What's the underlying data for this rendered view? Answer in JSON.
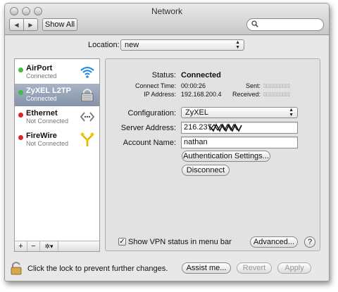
{
  "window": {
    "title": "Network"
  },
  "toolbar": {
    "show_all": "Show All",
    "search_placeholder": ""
  },
  "location": {
    "label": "Location:",
    "value": "new"
  },
  "services": [
    {
      "name": "AirPort",
      "status": "Connected",
      "dot_color": "#3fbf3f",
      "icon": "wifi-icon"
    },
    {
      "name": "ZyXEL L2TP",
      "status": "Connected",
      "dot_color": "#3fbf3f",
      "icon": "lock-icon"
    },
    {
      "name": "Ethernet",
      "status": "Not Connected",
      "dot_color": "#d62828",
      "icon": "ethernet-icon"
    },
    {
      "name": "FireWire",
      "status": "Not Connected",
      "dot_color": "#d62828",
      "icon": "firewire-icon"
    }
  ],
  "sidebar_footer": {
    "add": "+",
    "remove": "−",
    "gear": "✲▾"
  },
  "status": {
    "label": "Status:",
    "value": "Connected",
    "connect_time_label": "Connect Time:",
    "connect_time": "00:00:26",
    "ip_label": "IP Address:",
    "ip": "192.168.200.4",
    "sent_label": "Sent:",
    "received_label": "Received:",
    "meter": "▯▯▯▯▯▯▯▯▯▯"
  },
  "config": {
    "configuration_label": "Configuration:",
    "configuration_value": "ZyXEL",
    "server_label": "Server Address:",
    "server_value": "216.237.",
    "account_label": "Account Name:",
    "account_value": "nathan",
    "auth_button": "Authentication Settings...",
    "disconnect_button": "Disconnect"
  },
  "vpn_status": {
    "checkbox_checked": true,
    "label": "Show VPN status in menu bar"
  },
  "advanced_button": "Advanced...",
  "help_button": "?",
  "bottom": {
    "lock_text": "Click the lock to prevent further changes.",
    "assist": "Assist me...",
    "revert": "Revert",
    "apply": "Apply"
  }
}
